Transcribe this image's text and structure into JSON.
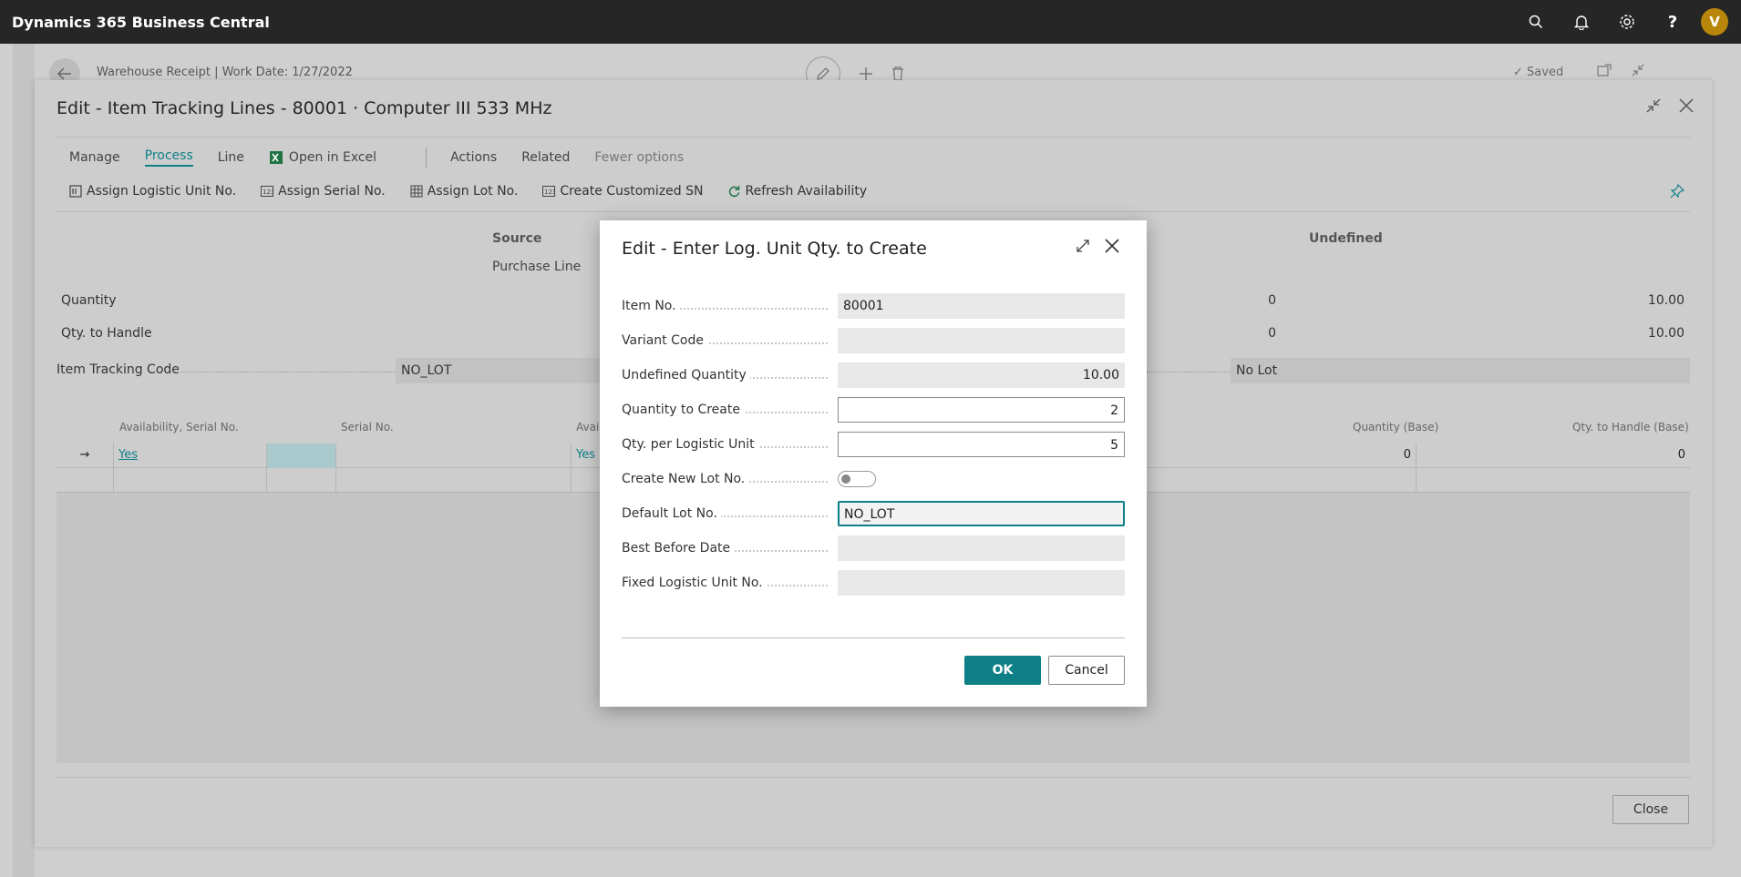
{
  "app": {
    "title": "Dynamics 365 Business Central",
    "user_initial": "V"
  },
  "page": {
    "breadcrumb": "Warehouse Receipt | Work Date: 1/27/2022",
    "saved_label": "Saved"
  },
  "panel": {
    "title": "Edit - Item Tracking Lines - 80001 · Computer III 533 MHz",
    "menu": {
      "manage": "Manage",
      "process": "Process",
      "line": "Line",
      "open_in_excel": "Open in Excel",
      "actions": "Actions",
      "related": "Related",
      "fewer_options": "Fewer options"
    },
    "actions": {
      "assign_logistic_unit": "Assign Logistic Unit No.",
      "assign_serial": "Assign Serial No.",
      "assign_lot": "Assign Lot No.",
      "create_customized_sn": "Create Customized SN",
      "refresh_availability": "Refresh Availability"
    },
    "summary": {
      "source_header": "Source",
      "source_value": "Purchase Line",
      "undefined_header": "Undefined",
      "quantity_label": "Quantity",
      "qty_to_handle_label": "Qty. to Handle",
      "qty_mid": "0",
      "qty_right": "10.00",
      "handle_mid": "0",
      "handle_right": "10.00",
      "item_tracking_code_label": "Item Tracking Code",
      "item_tracking_code_value": "NO_LOT",
      "item_tracking_desc": "No Lot"
    },
    "grid": {
      "columns": {
        "availability_serial": "Availability, Serial No.",
        "serial_no": "Serial No.",
        "avail_partial": "Avai",
        "quantity_base": "Quantity (Base)",
        "qty_to_handle_base": "Qty. to Handle (Base)"
      },
      "row1": {
        "availability_serial": "Yes",
        "avail_partial": "Yes",
        "quantity_base": "0",
        "qty_to_handle_base": "0"
      }
    },
    "close_label": "Close"
  },
  "dialog": {
    "title": "Edit - Enter Log. Unit Qty. to Create",
    "fields": {
      "item_no": {
        "label": "Item No.",
        "value": "80001"
      },
      "variant_code": {
        "label": "Variant Code",
        "value": ""
      },
      "undefined_quantity": {
        "label": "Undefined Quantity",
        "value": "10.00"
      },
      "quantity_to_create": {
        "label": "Quantity to Create",
        "value": "2"
      },
      "qty_per_logistic_unit": {
        "label": "Qty. per Logistic Unit",
        "value": "5"
      },
      "create_new_lot_no": {
        "label": "Create New Lot No.",
        "value": false
      },
      "default_lot_no": {
        "label": "Default Lot No.",
        "value": "NO_LOT"
      },
      "best_before_date": {
        "label": "Best Before Date",
        "value": ""
      },
      "fixed_logistic_unit_no": {
        "label": "Fixed Logistic Unit No.",
        "value": ""
      }
    },
    "ok_label": "OK",
    "cancel_label": "Cancel"
  },
  "colors": {
    "accent": "#0f7f87",
    "appbar": "#262626",
    "avatar": "#b8860b"
  },
  "icons": [
    "search-icon",
    "bell-icon",
    "gear-icon",
    "help-icon",
    "back-arrow-icon",
    "edit-pencil-icon",
    "plus-icon",
    "trash-icon",
    "checkmark-icon",
    "collapse-icon",
    "close-icon",
    "expand-icon",
    "excel-icon",
    "pin-icon",
    "refresh-icon",
    "row-arrow-icon"
  ]
}
